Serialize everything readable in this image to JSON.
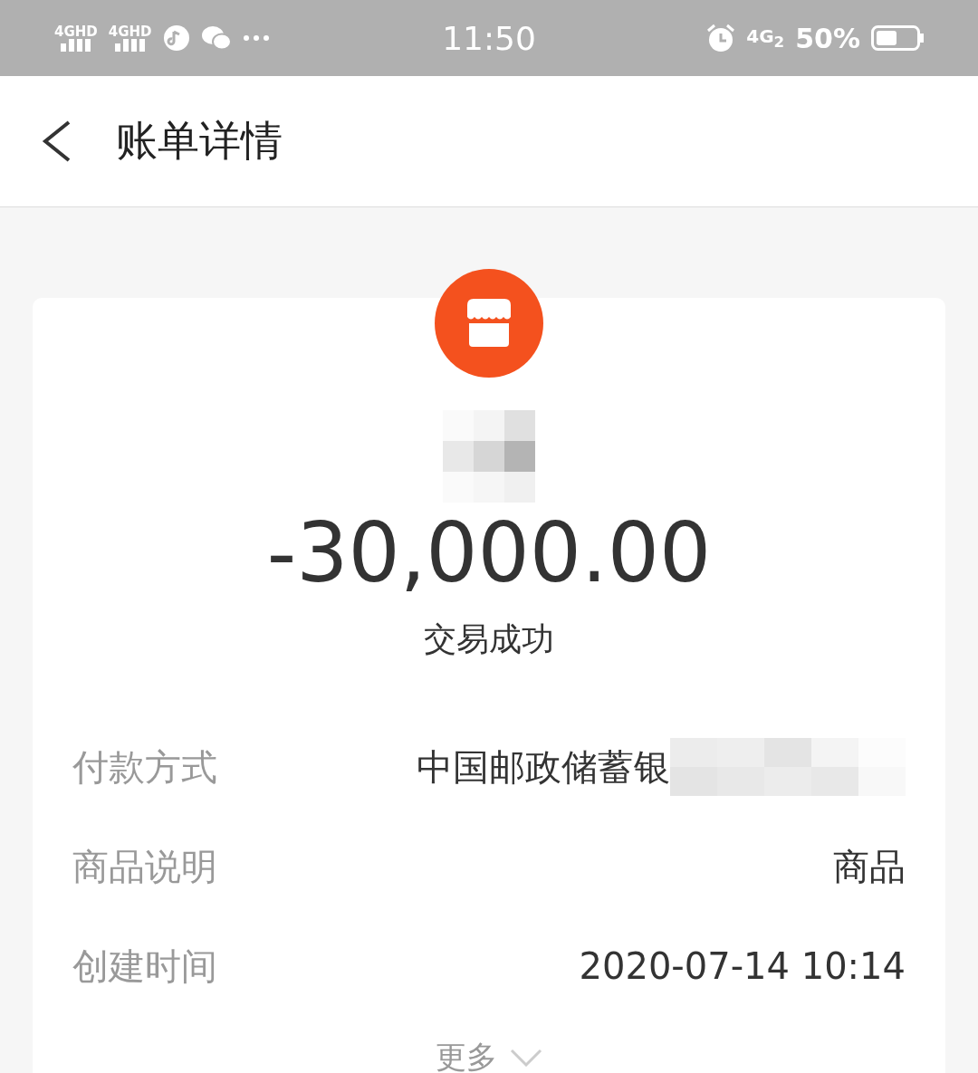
{
  "status_bar": {
    "networks": [
      "4GHD",
      "4GHD"
    ],
    "time": "11:50",
    "network_right": "4G$_{2}$",
    "battery": "50%"
  },
  "header": {
    "title": "账单详情"
  },
  "bill": {
    "amount": "-30,000.00",
    "status": "交易成功",
    "rows": [
      {
        "label": "付款方式",
        "value": "中国邮政储蓄银",
        "redacted": true
      },
      {
        "label": "商品说明",
        "value": "商品",
        "redacted": false
      },
      {
        "label": "创建时间",
        "value": "2020-07-14 10:14",
        "redacted": false
      }
    ],
    "more": "更多"
  }
}
